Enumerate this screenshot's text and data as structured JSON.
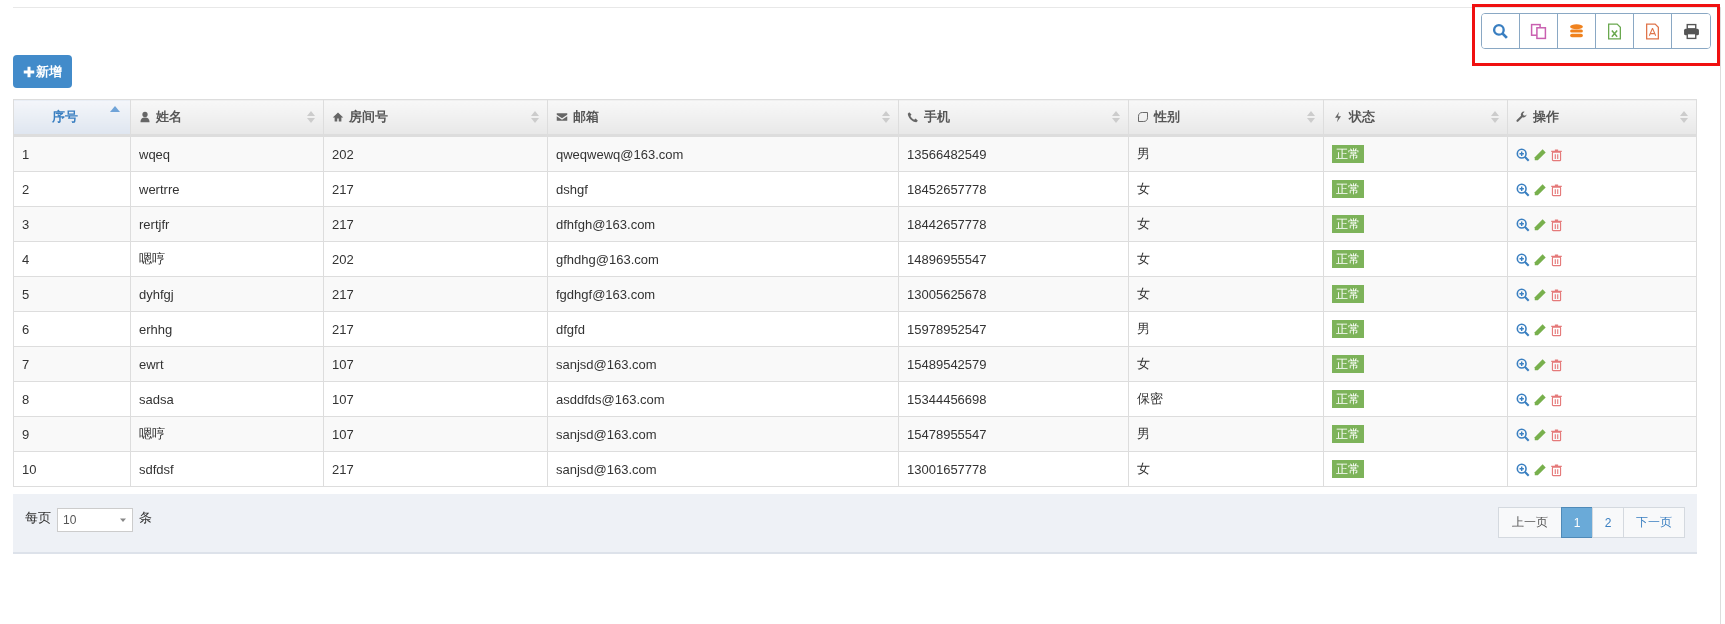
{
  "toolbar": {
    "highlighted": true,
    "buttons": [
      {
        "kind": "search"
      },
      {
        "kind": "copy"
      },
      {
        "kind": "database"
      },
      {
        "kind": "excel"
      },
      {
        "kind": "pdf"
      },
      {
        "kind": "print"
      }
    ]
  },
  "add_button": {
    "label": "新增"
  },
  "table": {
    "columns": [
      {
        "label": "序号",
        "sorted": true
      },
      {
        "label": "姓名",
        "sorted": false
      },
      {
        "label": "房间号",
        "sorted": false
      },
      {
        "label": "邮箱",
        "sorted": false
      },
      {
        "label": "手机",
        "sorted": false
      },
      {
        "label": "性别",
        "sorted": false
      },
      {
        "label": "状态",
        "sorted": false
      },
      {
        "label": "操作",
        "sorted": false
      }
    ],
    "rows": [
      {
        "cells": [
          "1",
          "wqeq",
          "202",
          "qweqwewq@163.com",
          "13566482549",
          "男"
        ],
        "status": "正常"
      },
      {
        "cells": [
          "2",
          "wertrre",
          "217",
          "dshgf",
          "18452657778",
          "女"
        ],
        "status": "正常"
      },
      {
        "cells": [
          "3",
          "rertjfr",
          "217",
          "dfhfgh@163.com",
          "18442657778",
          "女"
        ],
        "status": "正常"
      },
      {
        "cells": [
          "4",
          "嗯哼",
          "202",
          "gfhdhg@163.com",
          "14896955547",
          "女"
        ],
        "status": "正常"
      },
      {
        "cells": [
          "5",
          "dyhfgj",
          "217",
          "fgdhgf@163.com",
          "13005625678",
          "女"
        ],
        "status": "正常"
      },
      {
        "cells": [
          "6",
          "erhhg",
          "217",
          "dfgfd",
          "15978952547",
          "男"
        ],
        "status": "正常"
      },
      {
        "cells": [
          "7",
          "ewrt",
          "107",
          "sanjsd@163.com",
          "15489542579",
          "女"
        ],
        "status": "正常"
      },
      {
        "cells": [
          "8",
          "sadsa",
          "107",
          "asddfds@163.com",
          "15344456698",
          "保密"
        ],
        "status": "正常"
      },
      {
        "cells": [
          "9",
          "嗯哼",
          "107",
          "sanjsd@163.com",
          "15478955547",
          "男"
        ],
        "status": "正常"
      },
      {
        "cells": [
          "10",
          "sdfdsf",
          "217",
          "sanjsd@163.com",
          "13001657778",
          "女"
        ],
        "status": "正常"
      }
    ]
  },
  "footer": {
    "per_page_label": "每页",
    "page_size": "10",
    "unit_label": "条",
    "pages": [
      {
        "label": "上一页",
        "kind": "prev",
        "selected": false
      },
      {
        "label": "1",
        "kind": "page",
        "selected": true
      },
      {
        "label": "2",
        "kind": "page",
        "selected": false
      },
      {
        "label": "下一页",
        "kind": "next",
        "selected": false
      }
    ]
  }
}
